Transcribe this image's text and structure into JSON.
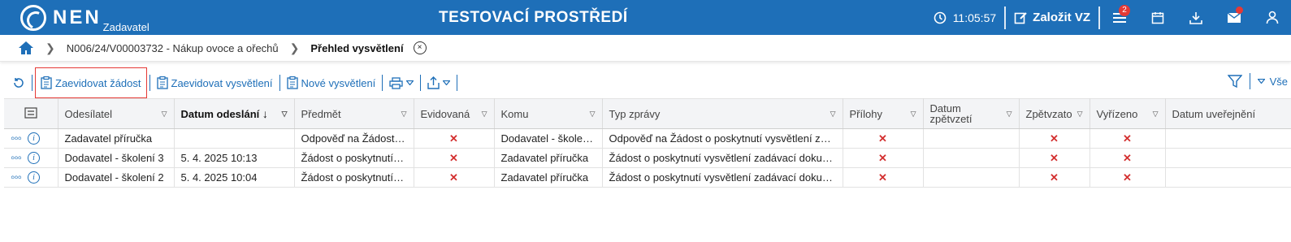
{
  "header": {
    "logo_text": "NEN",
    "logo_sub": "Zadavatel",
    "env_title": "TESTOVACÍ PROSTŘEDÍ",
    "clock": "11:05:57",
    "create_label": "Založit VZ",
    "menu_badge": "2",
    "icons": [
      "clock-icon",
      "edit-icon",
      "menu-icon",
      "calendar-icon",
      "download-icon",
      "mail-icon",
      "user-icon"
    ]
  },
  "breadcrumb": {
    "item1": "N006/24/V00003732 - Nákup ovoce a ořechů",
    "current": "Přehled vysvětlení",
    "close": "×"
  },
  "toolbar": {
    "zaevidovat_zadost": "Zaevidovat žádost",
    "zaevidovat_vysvetleni": "Zaevidovat vysvětlení",
    "nove_vysvetleni": "Nové vysvětlení",
    "filter_all": "Vše"
  },
  "table": {
    "columns": [
      "Odesílatel",
      "Datum odeslání",
      "Předmět",
      "Evidovaná",
      "Komu",
      "Typ zprávy",
      "Přílohy",
      "Datum zpětvzetí",
      "Zpětvzato",
      "Vyřízeno",
      "Datum uveřejnění"
    ],
    "rows": [
      {
        "odesilatel": "Zadavatel příručka",
        "datum": "",
        "predmet": "Odpověď na Žádost o...",
        "evidovana": "✕",
        "komu": "Dodavatel - školení...",
        "typ": "Odpověď na Žádost o poskytnutí vysvětlení zad...",
        "prilohy": "✕",
        "datum_zpet": "",
        "zpetvzato": "✕",
        "vyrizeno": "✕",
        "datum_uver": ""
      },
      {
        "odesilatel": "Dodavatel - školení 3",
        "datum": "5. 4. 2025 10:13",
        "predmet": "Žádost o poskytnutí v...",
        "evidovana": "✕",
        "komu": "Zadavatel příručka",
        "typ": "Žádost o poskytnutí vysvětlení zadávací dokum...",
        "prilohy": "✕",
        "datum_zpet": "",
        "zpetvzato": "✕",
        "vyrizeno": "✕",
        "datum_uver": ""
      },
      {
        "odesilatel": "Dodavatel - školení 2",
        "datum": "5. 4. 2025 10:04",
        "predmet": "Žádost o poskytnutí v...",
        "evidovana": "✕",
        "komu": "Zadavatel příručka",
        "typ": "Žádost o poskytnutí vysvětlení zadávací dokum...",
        "prilohy": "✕",
        "datum_zpet": "",
        "zpetvzato": "✕",
        "vyrizeno": "✕",
        "datum_uver": ""
      }
    ]
  },
  "colors": {
    "brand": "#1e6fb8",
    "highlight": "#e53935",
    "cross": "#d32f2f"
  }
}
